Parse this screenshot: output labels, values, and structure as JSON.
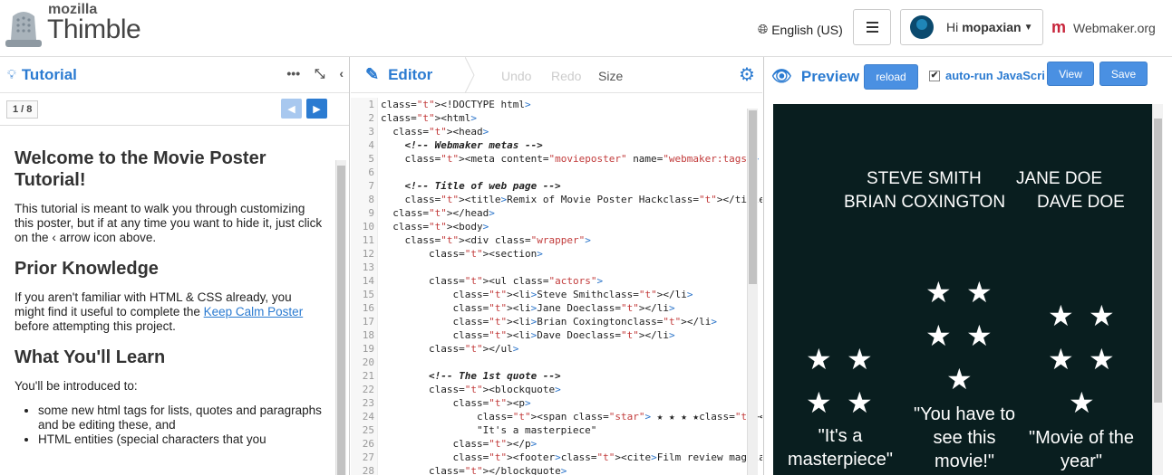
{
  "brand": {
    "small": "mozilla",
    "big": "Thimble"
  },
  "header": {
    "language": "English (US)",
    "greeting": "Hi",
    "username": "mopaxian",
    "webmaker": "Webmaker.org"
  },
  "tutorial": {
    "title": "Tutorial",
    "page": "1 / 8",
    "heading1": "Welcome to the Movie Poster Tutorial!",
    "intro_a": "This tutorial is meant to walk you through customizing this poster, but if at any time you want to hide it, just click on the",
    "intro_b": "arrow icon above.",
    "heading2": "Prior Knowledge",
    "prior_a": "If you aren't familiar with HTML & CSS already, you might find it useful to complete the",
    "prior_link": "Keep Calm Poster",
    "prior_b": "before attempting this project.",
    "heading3": "What You'll Learn",
    "learn_intro": "You'll be introduced to:",
    "bullets": [
      "some new html tags for lists, quotes and paragraphs and be editing these, and",
      "HTML entities (special characters that you"
    ]
  },
  "editor": {
    "title": "Editor",
    "undo": "Undo",
    "redo": "Redo",
    "size": "Size",
    "lines": [
      "<!DOCTYPE html>",
      "<html>",
      "  <head>",
      "    <!-- Webmaker metas -->",
      "    <meta content=\"movieposter\" name=\"webmaker:tags\">",
      "",
      "    <!-- Title of web page -->",
      "    <title>Remix of Movie Poster Hack</title>",
      "  </head>",
      "  <body>",
      "    <div class=\"wrapper\">",
      "        <section>",
      "",
      "        <ul class=\"actors\">",
      "            <li>Steve Smith</li>",
      "            <li>Jane Doe</li>",
      "            <li>Brian Coxington</li>",
      "            <li>Dave Doe</li>",
      "        </ul>",
      "",
      "        <!-- The 1st quote -->",
      "        <blockquote>",
      "            <p>",
      "                <span class=\"star\"> ★ ★ ★ ★</span>",
      "                \"It's a masterpiece\"",
      "            </p>",
      "            <footer><cite>Film review mag</cite></footer>",
      "        </blockquote>"
    ]
  },
  "preview": {
    "title": "Preview",
    "reload": "reload",
    "autorun": "auto-run JavaScri",
    "view": "View",
    "save": "Save",
    "actors": [
      "STEVE SMITH",
      "JANE DOE",
      "BRIAN COXINGTON",
      "DAVE DOE"
    ],
    "star": "★",
    "quotes": [
      "\"It's a masterpiece\"",
      "\"You have to see this movie!\"",
      "\"Movie of the year\""
    ]
  }
}
